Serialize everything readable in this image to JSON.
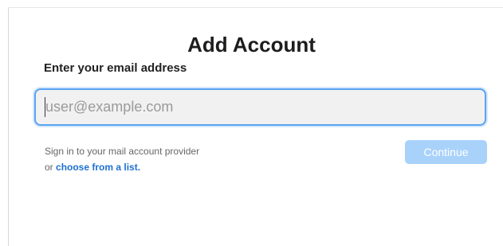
{
  "dialog": {
    "title": "Add Account",
    "email_label": "Enter your email address",
    "email_placeholder": "user@example.com",
    "email_value": "",
    "help_line1": "Sign in to your mail account provider",
    "help_line2_prefix": "or ",
    "help_link": "choose from a list.",
    "continue_label": "Continue",
    "continue_enabled": false
  },
  "colors": {
    "accent": "#5aa3f1",
    "link": "#1e6fd0",
    "continue_disabled_bg": "#a9d2fb"
  }
}
